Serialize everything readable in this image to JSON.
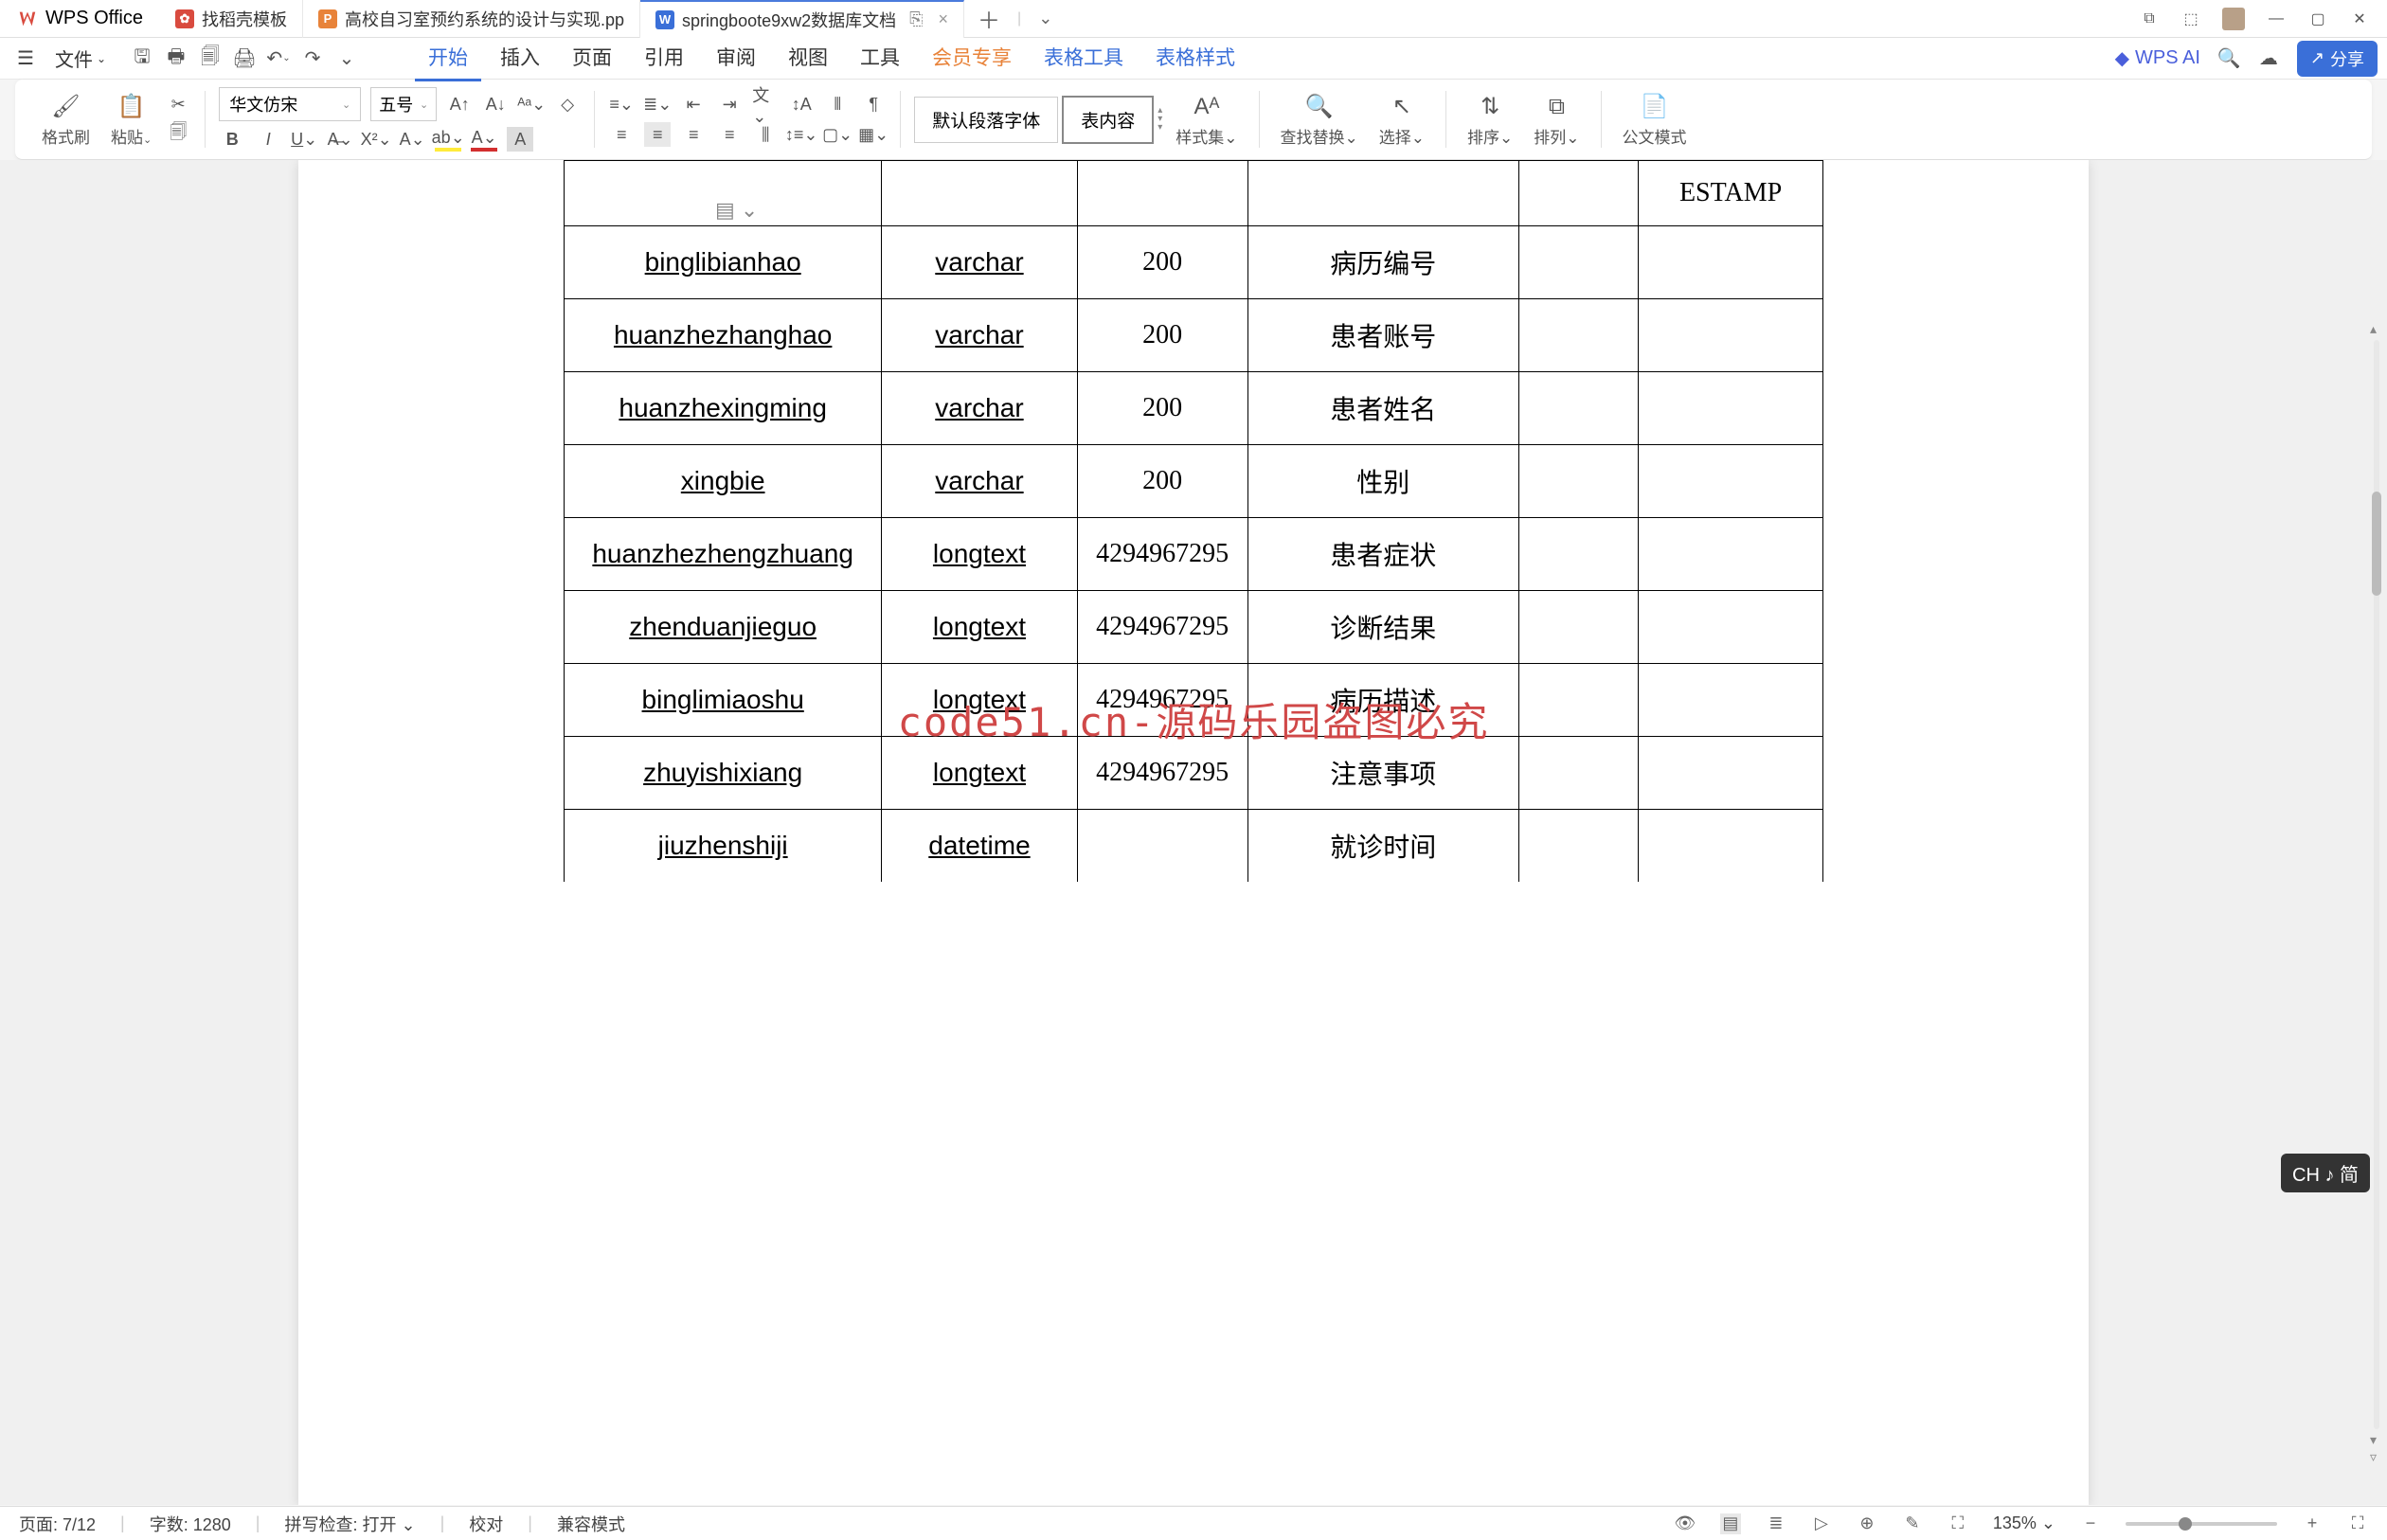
{
  "app": {
    "name": "WPS Office"
  },
  "tabs": [
    {
      "icon_bg": "#d94b3f",
      "icon": "✿",
      "label": "找稻壳模板"
    },
    {
      "icon_bg": "#e8833a",
      "icon": "P",
      "label": "高校自习室预约系统的设计与实现.pp"
    },
    {
      "icon_bg": "#3a6fd8",
      "icon": "W",
      "label": "springboote9xw2数据库文档",
      "active": true
    }
  ],
  "menu": {
    "file": "文件",
    "items": [
      "开始",
      "插入",
      "页面",
      "引用",
      "审阅",
      "视图",
      "工具",
      "会员专享",
      "表格工具",
      "表格样式"
    ],
    "active_index": 0,
    "accent_indices": [
      8,
      9
    ],
    "wps_ai": "WPS AI",
    "share": "分享"
  },
  "ribbon": {
    "format_painter": "格式刷",
    "paste": "粘贴",
    "font": "华文仿宋",
    "size": "五号",
    "para_style_default": "默认段落字体",
    "para_style_content": "表内容",
    "styles": "样式集",
    "find_replace": "查找替换",
    "select": "选择",
    "sort1": "排序",
    "sort2": "排列",
    "doc_mode": "公文模式"
  },
  "table": {
    "header_partial": "ESTAMP",
    "rows": [
      {
        "c1": "binglibianhao",
        "c2": "varchar",
        "c3": "200",
        "c4": "病历编号",
        "c5": "",
        "c6": ""
      },
      {
        "c1": "huanzhezhanghao",
        "c2": "varchar",
        "c3": "200",
        "c4": "患者账号",
        "c5": "",
        "c6": ""
      },
      {
        "c1": "huanzhexingming",
        "c2": "varchar",
        "c3": "200",
        "c4": "患者姓名",
        "c5": "",
        "c6": ""
      },
      {
        "c1": "xingbie",
        "c2": "varchar",
        "c3": "200",
        "c4": "性别",
        "c5": "",
        "c6": ""
      },
      {
        "c1": "huanzhezhengzhuang",
        "c2": "longtext",
        "c3": "4294967295",
        "c4": "患者症状",
        "c5": "",
        "c6": ""
      },
      {
        "c1": "zhenduanjieguo",
        "c2": "longtext",
        "c3": "4294967295",
        "c4": "诊断结果",
        "c5": "",
        "c6": ""
      },
      {
        "c1": "binglimiaoshu",
        "c2": "longtext",
        "c3": "4294967295",
        "c4": "病历描述",
        "c5": "",
        "c6": ""
      },
      {
        "c1": "zhuyishixiang",
        "c2": "longtext",
        "c3": "4294967295",
        "c4": "注意事项",
        "c5": "",
        "c6": ""
      },
      {
        "c1": "jiuzhenshiji",
        "c2": "datetime",
        "c3": "",
        "c4": "就诊时间",
        "c5": "",
        "c6": ""
      }
    ]
  },
  "watermark": "code51.cn-源码乐园盗图必究",
  "status": {
    "page": "页面: 7/12",
    "words": "字数: 1280",
    "spell": "拼写检查: 打开",
    "review": "校对",
    "compat": "兼容模式",
    "zoom": "135%"
  },
  "ime": "CH ♪ 简"
}
